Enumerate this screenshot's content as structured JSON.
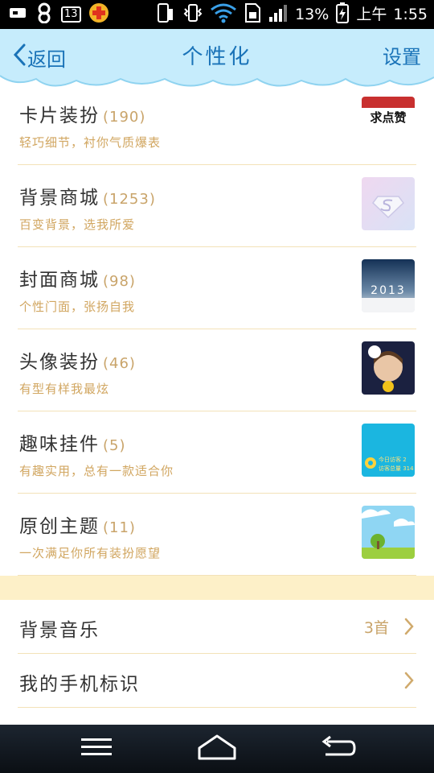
{
  "status_bar": {
    "notif_count": "13",
    "battery": "13%",
    "period": "上午",
    "time": "1:55"
  },
  "header": {
    "back_label": "返回",
    "title": "个性化",
    "settings_label": "设置"
  },
  "items": [
    {
      "name": "卡片装扮",
      "count": "(190)",
      "sub": "轻巧细节，衬你气质爆表"
    },
    {
      "name": "背景商城",
      "count": "(1253)",
      "sub": "百变背景，选我所爱"
    },
    {
      "name": "封面商城",
      "count": "(98)",
      "sub": "个性门面，张扬自我"
    },
    {
      "name": "头像装扮",
      "count": "(46)",
      "sub": "有型有样我最炫"
    },
    {
      "name": "趣味挂件",
      "count": "(5)",
      "sub": "有趣实用，总有一款适合你"
    },
    {
      "name": "原创主题",
      "count": "(11)",
      "sub": "一次满足你所有装扮愿望"
    }
  ],
  "thumb_text": {
    "card": "求点赞",
    "cover": "2013",
    "widget_line1": "今日访客 2",
    "widget_line2": "访客总量 314"
  },
  "rows": [
    {
      "label": "背景音乐",
      "value": "3首"
    },
    {
      "label": "我的手机标识",
      "value": ""
    }
  ],
  "colors": {
    "header_bg": "#bfe9fb",
    "accent_blue": "#1a73b8",
    "subtitle_gold": "#d1a660",
    "band": "#fdf0c8"
  }
}
